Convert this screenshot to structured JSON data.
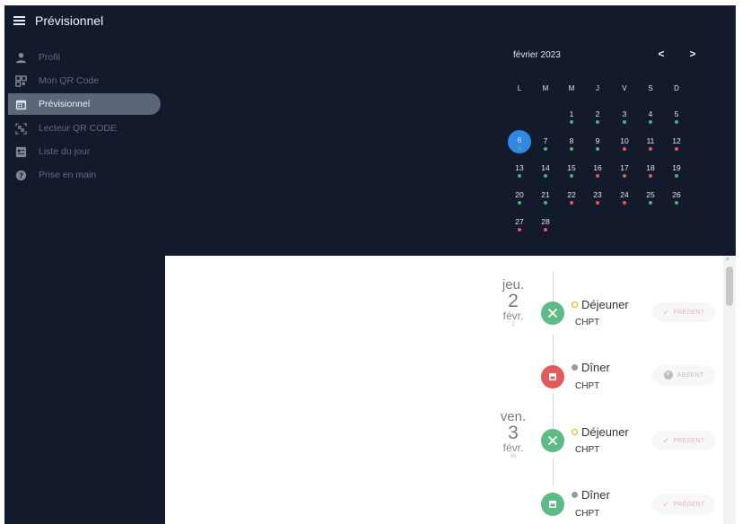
{
  "app": {
    "title": "Prévisionnel"
  },
  "sidebar": {
    "items": [
      {
        "label": "Profil"
      },
      {
        "label": "Mon QR Code"
      },
      {
        "label": "Prévisionnel"
      },
      {
        "label": "Lecteur QR CODE"
      },
      {
        "label": "Liste du jour"
      },
      {
        "label": "Prise en main"
      }
    ]
  },
  "calendar": {
    "month": "février 2023",
    "prev_icon": "<",
    "next_icon": ">",
    "weekdays": [
      "L",
      "M",
      "M",
      "J",
      "V",
      "S",
      "D"
    ],
    "selected_day": "6",
    "days": [
      "1",
      "2",
      "3",
      "4",
      "5",
      "6",
      "7",
      "8",
      "9",
      "10",
      "11",
      "12",
      "13",
      "14",
      "15",
      "16",
      "17",
      "18",
      "19",
      "20",
      "21",
      "22",
      "23",
      "24",
      "25",
      "26",
      "27",
      "28"
    ],
    "colors": {
      "green": "#4caf7a",
      "red": "#e05a5a",
      "selected": "#2f88e3"
    }
  },
  "timeline": {
    "days": [
      {
        "dow": "jeu.",
        "num": "2",
        "month": "févr.",
        "sub": "1"
      },
      {
        "dow": "ven.",
        "num": "3",
        "month": "févr.",
        "sub": "IN"
      }
    ],
    "entries": [
      {
        "title": "Déjeuner",
        "site": "CHPT",
        "status": "PRÉSENT",
        "status_glyph": "✓",
        "icon": "utensils-icon"
      },
      {
        "title": "Dîner",
        "site": "CHPT",
        "status": "ABSENT",
        "status_glyph": "✕",
        "icon": "tray-icon"
      },
      {
        "title": "Déjeuner",
        "site": "CHPT",
        "status": "PRÉSENT",
        "status_glyph": "✓",
        "icon": "utensils-icon"
      },
      {
        "title": "Dîner",
        "site": "CHPT",
        "status": "PRÉSENT",
        "status_glyph": "✓",
        "icon": "tray-icon"
      }
    ],
    "scroll_up_glyph": "^"
  }
}
